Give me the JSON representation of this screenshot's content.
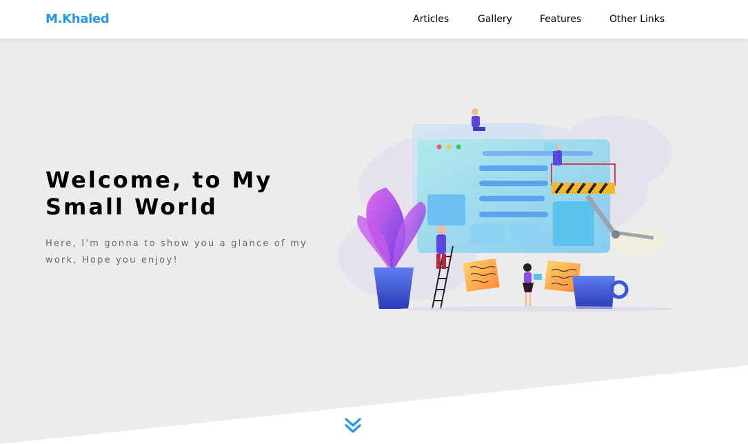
{
  "header": {
    "logo": "M.Khaled",
    "nav": [
      {
        "label": "Articles"
      },
      {
        "label": "Gallery"
      },
      {
        "label": "Features"
      },
      {
        "label": "Other Links"
      }
    ]
  },
  "landing": {
    "title_line1": "Welcome, to My",
    "title_line2": "Small World",
    "description": "Here, I'm gonna to show you a glance of my work, Hope you enjoy!",
    "illustration": "landing-image",
    "down_icon": "angles-down-icon"
  },
  "colors": {
    "accent": "#2196f3",
    "background": "#ececec",
    "text": "#000000",
    "muted": "#666666"
  }
}
